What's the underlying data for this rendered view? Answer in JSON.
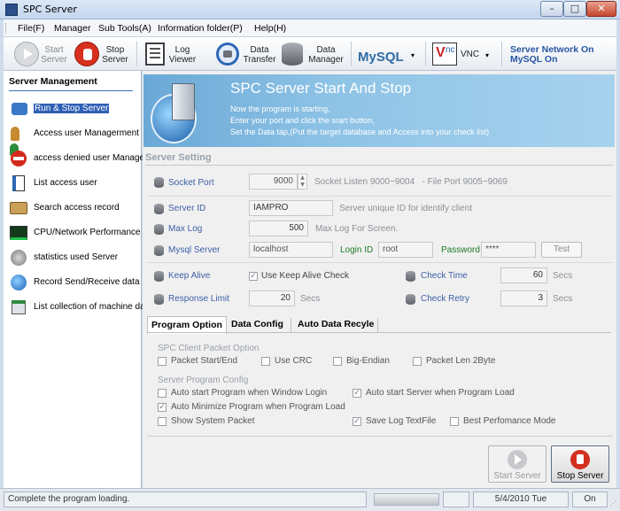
{
  "window": {
    "title": "SPC Server",
    "controls": {
      "minimize": "–",
      "maximize": "□",
      "close": "✕"
    }
  },
  "menu": [
    "File(F)",
    "Manager",
    "Sub Tools(A)",
    "Information folder(P)",
    "Help(H)"
  ],
  "toolbar": {
    "start": [
      "Start",
      "Server"
    ],
    "stop": [
      "Stop",
      "Server"
    ],
    "log": [
      "Log",
      "Viewer"
    ],
    "transfer": [
      "Data",
      "Transfer"
    ],
    "manager": [
      "Data",
      "Manager"
    ],
    "mysql": "MySQL",
    "vnc": "VNC",
    "status": [
      "Server Network On",
      "MySQL On"
    ]
  },
  "sidebar": {
    "title": "Server Management",
    "items": [
      {
        "label": "Run & Stop Server",
        "icon": "network-pc-icon"
      },
      {
        "label": "Access user Managerment",
        "icon": "users-icon"
      },
      {
        "label": "access denied user Manage",
        "icon": "denied-icon"
      },
      {
        "label": "List access user",
        "icon": "list-icon"
      },
      {
        "label": "Search access record",
        "icon": "search-record-icon"
      },
      {
        "label": "CPU/Network Performance",
        "icon": "performance-icon"
      },
      {
        "label": "statistics used Server",
        "icon": "statistics-icon"
      },
      {
        "label": "Record Send/Receive data",
        "icon": "globe-icon"
      },
      {
        "label": "List collection of machine da",
        "icon": "machine-icon"
      }
    ]
  },
  "banner": {
    "title": "SPC Server Start And Stop",
    "lines": [
      "Now the program is starting,",
      "Enter your port and click the srart button,",
      "Set the Data tap,(Put the target database and Access  into your check list)"
    ]
  },
  "settings": {
    "title": "Server Setting",
    "socket_port": {
      "label": "Socket Port",
      "value": "9000",
      "hint": "Socket Listen 9000~9004   - File Port 9005~9069"
    },
    "server_id": {
      "label": "Server ID",
      "value": "IAMPRO",
      "hint": "Server unique ID for identify client"
    },
    "max_log": {
      "label": "Max Log",
      "value": "500",
      "hint": "Max Log For Screen."
    },
    "mysql_server": {
      "label": "Mysql Server",
      "value": "localhost",
      "login_label": "Login ID",
      "login": "root",
      "password_label": "Password",
      "password": "****",
      "test": "Test"
    },
    "keep_alive": {
      "label": "Keep Alive",
      "check_label": "Use Keep Alive Check",
      "checked": true
    },
    "check_time": {
      "label": "Check Time",
      "value": "60",
      "unit": "Secs"
    },
    "response_limit": {
      "label": "Response Limit",
      "value": "20",
      "unit": "Secs"
    },
    "check_retry": {
      "label": "Check Retry",
      "value": "3",
      "unit": "Secs"
    }
  },
  "tabs": [
    "Program Option",
    "Data Config",
    "Auto Data Recyle"
  ],
  "program_option": {
    "packet_title": "SPC Client Packet Option",
    "packet_options": [
      {
        "label": "Packet Start/End",
        "checked": false
      },
      {
        "label": "Use CRC",
        "checked": false
      },
      {
        "label": "Big-Endian",
        "checked": false
      },
      {
        "label": "Packet Len 2Byte",
        "checked": false
      }
    ],
    "config_title": "Server Program Config",
    "config_options": [
      {
        "label": "Auto start Program when Window Login",
        "checked": false
      },
      {
        "label": "Auto start Server when Program Load",
        "checked": true
      },
      {
        "label": "Auto Minimize Program when Program Load",
        "checked": true
      },
      {
        "label": "Show System Packet",
        "checked": false
      },
      {
        "label": "Save Log TextFile",
        "checked": true
      },
      {
        "label": "Best Perfomance Mode",
        "checked": false
      }
    ]
  },
  "buttons": {
    "start": "Start Server",
    "stop": "Stop Server"
  },
  "status": {
    "message": "Complete the program loading.",
    "date": "5/4/2010 Tue",
    "state": "On"
  }
}
